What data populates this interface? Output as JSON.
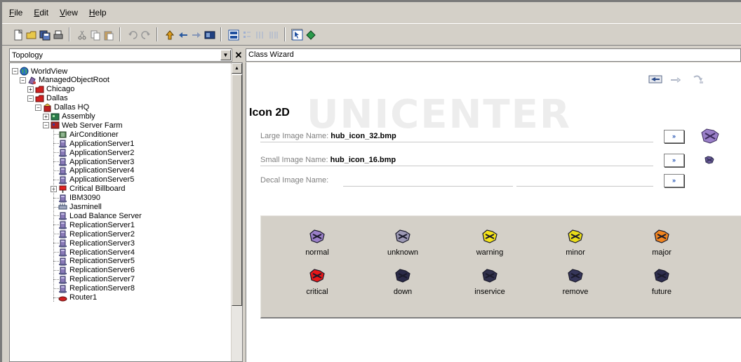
{
  "menu": [
    {
      "label": "File",
      "mnemonic": "F"
    },
    {
      "label": "Edit",
      "mnemonic": "E"
    },
    {
      "label": "View",
      "mnemonic": "V"
    },
    {
      "label": "Help",
      "mnemonic": "H"
    }
  ],
  "toolbar": {
    "icons": [
      "new-icon",
      "open-icon",
      "save-all-icon",
      "print-icon",
      "cut-icon",
      "copy-icon",
      "paste-icon",
      "undo-icon",
      "redo-icon",
      "up-arrow-icon",
      "back-arrow-icon",
      "forward-arrow-icon",
      "explorer-icon",
      "large-icons-view-icon",
      "small-icons-view-icon",
      "list-view-icon",
      "details-view-icon",
      "selector-icon",
      "diamond-icon"
    ]
  },
  "left_pane": {
    "combo_value": "Topology",
    "close_glyph": "✕",
    "tree": [
      {
        "label": "WorldView",
        "depth": 0,
        "expander": "−",
        "icon": "globe-icon"
      },
      {
        "label": "ManagedObjectRoot",
        "depth": 1,
        "expander": "−",
        "icon": "managed-object-root-icon"
      },
      {
        "label": "Chicago",
        "depth": 2,
        "expander": "+",
        "icon": "red-folder-icon"
      },
      {
        "label": "Dallas",
        "depth": 2,
        "expander": "−",
        "icon": "red-folder-icon"
      },
      {
        "label": "Dallas HQ",
        "depth": 3,
        "expander": "−",
        "icon": "building-icon"
      },
      {
        "label": "Assembly",
        "depth": 4,
        "expander": "+",
        "icon": "assembly-icon"
      },
      {
        "label": "Web Server Farm",
        "depth": 4,
        "expander": "−",
        "icon": "server-farm-icon"
      },
      {
        "label": "AirConditioner",
        "depth": 5,
        "expander": "",
        "icon": "air-conditioner-icon"
      },
      {
        "label": "ApplicationServer1",
        "depth": 5,
        "expander": "",
        "icon": "server-icon"
      },
      {
        "label": "ApplicationServer2",
        "depth": 5,
        "expander": "",
        "icon": "server-icon"
      },
      {
        "label": "ApplicationServer3",
        "depth": 5,
        "expander": "",
        "icon": "server-icon"
      },
      {
        "label": "ApplicationServer4",
        "depth": 5,
        "expander": "",
        "icon": "server-icon"
      },
      {
        "label": "ApplicationServer5",
        "depth": 5,
        "expander": "",
        "icon": "server-icon"
      },
      {
        "label": "Critical Billboard",
        "depth": 5,
        "expander": "+",
        "icon": "billboard-icon"
      },
      {
        "label": "IBM3090",
        "depth": 5,
        "expander": "",
        "icon": "server-icon"
      },
      {
        "label": "Jasminell",
        "depth": 5,
        "expander": "",
        "icon": "network-device-icon"
      },
      {
        "label": "Load Balance Server",
        "depth": 5,
        "expander": "",
        "icon": "server-icon"
      },
      {
        "label": "ReplicationServer1",
        "depth": 5,
        "expander": "",
        "icon": "server-icon"
      },
      {
        "label": "ReplicationServer2",
        "depth": 5,
        "expander": "",
        "icon": "server-icon"
      },
      {
        "label": "ReplicationServer3",
        "depth": 5,
        "expander": "",
        "icon": "server-icon"
      },
      {
        "label": "ReplicationServer4",
        "depth": 5,
        "expander": "",
        "icon": "server-icon"
      },
      {
        "label": "ReplicationServer5",
        "depth": 5,
        "expander": "",
        "icon": "server-icon"
      },
      {
        "label": "ReplicationServer6",
        "depth": 5,
        "expander": "",
        "icon": "server-icon"
      },
      {
        "label": "ReplicationServer7",
        "depth": 5,
        "expander": "",
        "icon": "server-icon"
      },
      {
        "label": "ReplicationServer8",
        "depth": 5,
        "expander": "",
        "icon": "server-icon"
      },
      {
        "label": "Router1",
        "depth": 5,
        "expander": "",
        "icon": "router-icon"
      }
    ]
  },
  "right_pane": {
    "header": "Class Wizard",
    "nav_icons": [
      "back-icon",
      "next-icon",
      "finish-icon"
    ],
    "watermark": "UNICENTER",
    "title": "Icon 2D",
    "fields": [
      {
        "label": "Large Image Name:",
        "value": "hub_icon_32.bmp",
        "browse": "»",
        "preview": "large-hub-icon"
      },
      {
        "label": "Small Image Name:",
        "value": "hub_icon_16.bmp",
        "browse": "»",
        "preview": "small-hub-icon"
      },
      {
        "label": "Decal Image Name:",
        "value": "",
        "browse": "»",
        "preview": ""
      }
    ],
    "states": [
      {
        "label": "normal",
        "color": "#9a7fc8"
      },
      {
        "label": "unknown",
        "color": "#9d99b5"
      },
      {
        "label": "warning",
        "color": "#f5e41a"
      },
      {
        "label": "minor",
        "color": "#e9dc18"
      },
      {
        "label": "major",
        "color": "#f2851e"
      },
      {
        "label": "critical",
        "color": "#e81818"
      },
      {
        "label": "down",
        "color": "#2a2a48"
      },
      {
        "label": "inservice",
        "color": "#30304c"
      },
      {
        "label": "remove",
        "color": "#36365a"
      },
      {
        "label": "future",
        "color": "#2e2e4e"
      }
    ]
  },
  "colors": {
    "window_bg": "#d4d0c8",
    "pane_bg": "#ffffff",
    "browse_arrow": "#2050b0"
  }
}
